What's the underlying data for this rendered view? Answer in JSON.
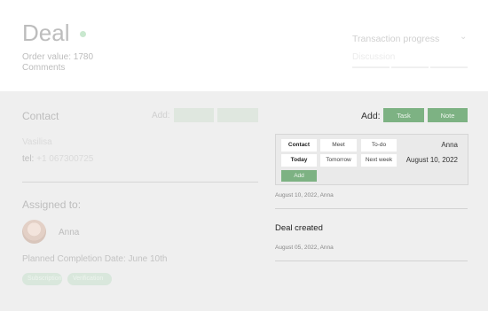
{
  "deal": {
    "title": "Deal",
    "order_value": "Order value: 1780",
    "comments": "Comments"
  },
  "transaction": {
    "label": "Transaction progress",
    "stage": "Discussion"
  },
  "contact": {
    "title": "Contact",
    "add_label": "Add:",
    "name": "Vasilisa",
    "tel_label": "tel:",
    "tel_value": "+1 067300725"
  },
  "assigned": {
    "title": "Assigned to:",
    "name": "Anna",
    "planned": "Planned Completion Date: June 10th",
    "tags": [
      "Subscription",
      "Verification"
    ]
  },
  "actions": {
    "add_label": "Add:",
    "task": "Task",
    "note": "Note"
  },
  "task_panel": {
    "types": [
      "Contact",
      "Meet",
      "To-do"
    ],
    "when": [
      "Today",
      "Tomorrow",
      "Next week"
    ],
    "add": "Add",
    "assignee": "Anna",
    "date": "August 10, 2022"
  },
  "feed": {
    "first_meta": "August 10, 2022, Anna",
    "event_title": "Deal created",
    "event_meta": "August 05, 2022, Anna"
  },
  "colors": {
    "accent": "#7db283",
    "background": "#efefef",
    "header": "#ffffff"
  }
}
